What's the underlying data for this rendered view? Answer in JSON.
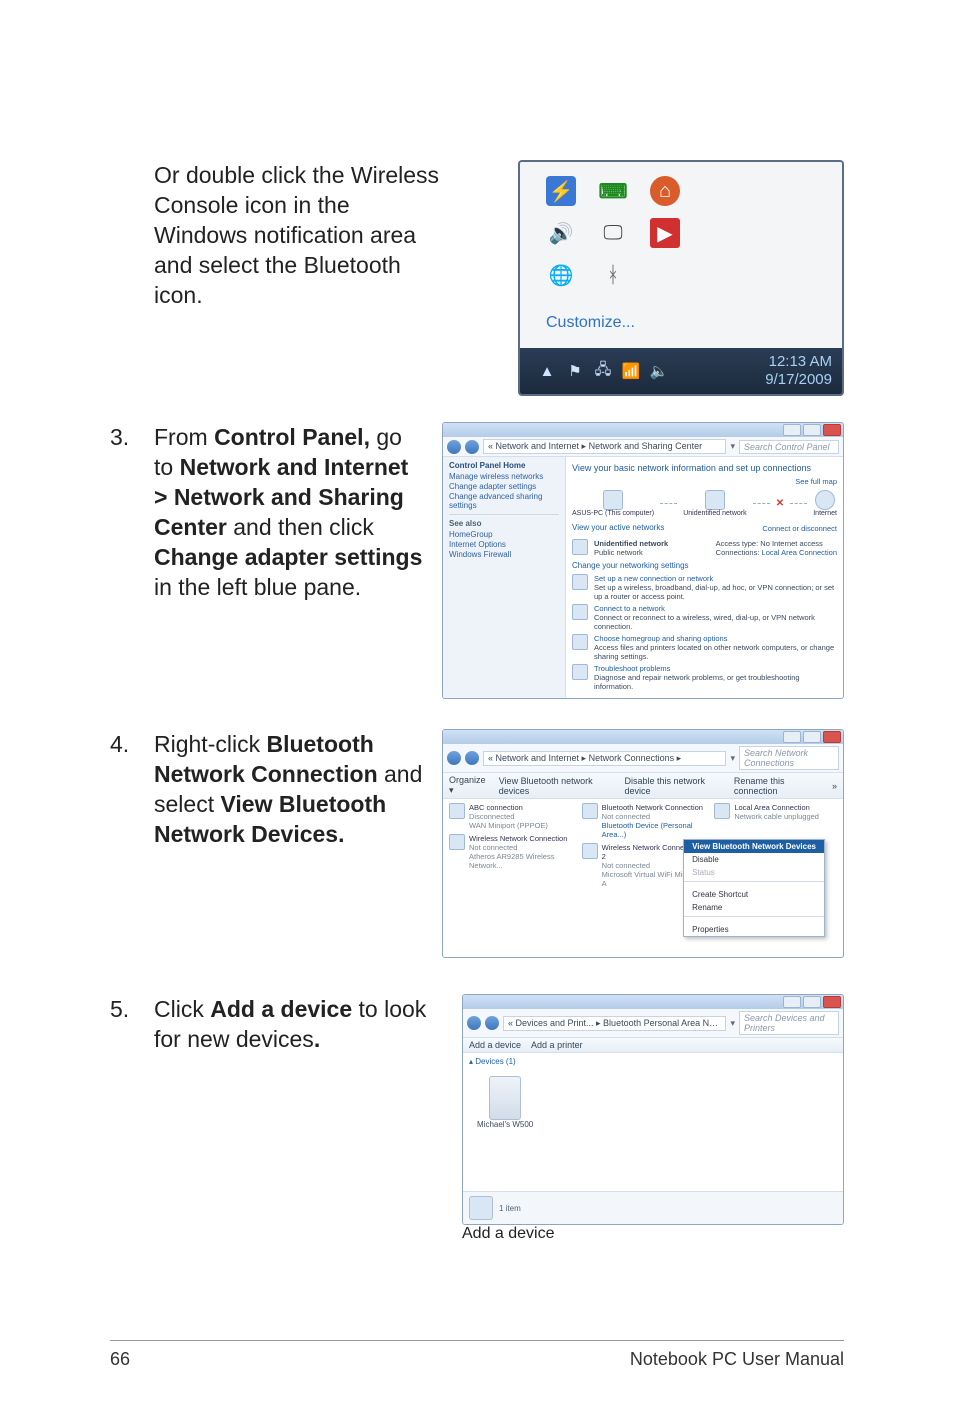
{
  "intro": {
    "text": "Or double click the Wireless Console icon in the Windows notification area and select the Bluetooth icon."
  },
  "fig1": {
    "customize": "Customize...",
    "time": "12:13 AM",
    "date": "9/17/2009"
  },
  "step3": {
    "num": "3.",
    "pre": "From ",
    "b1": "Control Panel,",
    "mid1": " go to ",
    "b2": "Network and Internet > Network and Sharing Center",
    "mid2": " and then click ",
    "b3": "Change adapter settings",
    "post": " in the left blue pane."
  },
  "fig2": {
    "crumb": "« Network and Internet ▸ Network and Sharing Center",
    "search": "Search Control Panel",
    "sidebar_title": "Control Panel Home",
    "sidebar_links": [
      "Manage wireless networks",
      "Change adapter settings",
      "Change advanced sharing settings"
    ],
    "see_also_title": "See also",
    "see_also": [
      "HomeGroup",
      "Internet Options",
      "Windows Firewall"
    ],
    "head": "View your basic network information and set up connections",
    "full_map": "See full map",
    "nodes": [
      "ASUS-PC (This computer)",
      "Unidentified network",
      "Internet"
    ],
    "active_head": "View your active networks",
    "connect_link": "Connect or disconnect",
    "unet_title": "Unidentified network",
    "unet_sub": "Public network",
    "access_label": "Access type:",
    "access_val": "No Internet access",
    "conn_label": "Connections:",
    "conn_val": "Local Area Connection",
    "change_head": "Change your networking settings",
    "rows": [
      {
        "title": "Set up a new connection or network",
        "sub": "Set up a wireless, broadband, dial-up, ad hoc, or VPN connection; or set up a router or access point."
      },
      {
        "title": "Connect to a network",
        "sub": "Connect or reconnect to a wireless, wired, dial-up, or VPN network connection."
      },
      {
        "title": "Choose homegroup and sharing options",
        "sub": "Access files and printers located on other network computers, or change sharing settings."
      },
      {
        "title": "Troubleshoot problems",
        "sub": "Diagnose and repair network problems, or get troubleshooting information."
      }
    ]
  },
  "step4": {
    "num": "4.",
    "pre": "Right-click ",
    "b1": "Bluetooth Network Connection",
    "mid": " and select ",
    "b2": "View Bluetooth Network Devices."
  },
  "fig3": {
    "crumb": "« Network and Internet ▸ Network Connections ▸",
    "search": "Search Network Connections",
    "toolbar": [
      "Organize ▾",
      "View Bluetooth network devices",
      "Disable this network device",
      "Rename this connection",
      "»"
    ],
    "items_left": [
      {
        "title": "ABC connection",
        "sub": "Disconnected",
        "sub2": "WAN Miniport (PPPOE)"
      },
      {
        "title": "Wireless Network Connection",
        "sub": "Not connected",
        "sub2": "Atheros AR9285 Wireless Network..."
      }
    ],
    "items_mid": [
      {
        "title": "Bluetooth Network Connection",
        "sub": "Not connected",
        "sub2": "Bluetooth Device (Personal Area...)"
      },
      {
        "title": "Wireless Network Connection 2",
        "sub": "Not connected",
        "sub2": "Microsoft Virtual WiFi Miniport A"
      }
    ],
    "items_right": [
      {
        "title": "Local Area Connection",
        "sub": "Network cable unplugged"
      }
    ],
    "menu": [
      "View Bluetooth Network Devices",
      "Disable",
      "Status",
      "Create Shortcut",
      "Rename",
      "Properties"
    ]
  },
  "step5": {
    "num": "5.",
    "pre": "Click ",
    "b1": "Add a device",
    "mid": " to look for new devices",
    "post": "."
  },
  "fig4": {
    "crumb": "« Devices and Print... ▸ Bluetooth Personal Area Network Devices",
    "search": "Search Devices and Printers",
    "toolbar": [
      "Add a device",
      "Add a printer"
    ],
    "group": "▴ Devices (1)",
    "device": "Michael's W500",
    "status": "1 item"
  },
  "footer": {
    "page": "66",
    "title": "Notebook PC User Manual"
  }
}
